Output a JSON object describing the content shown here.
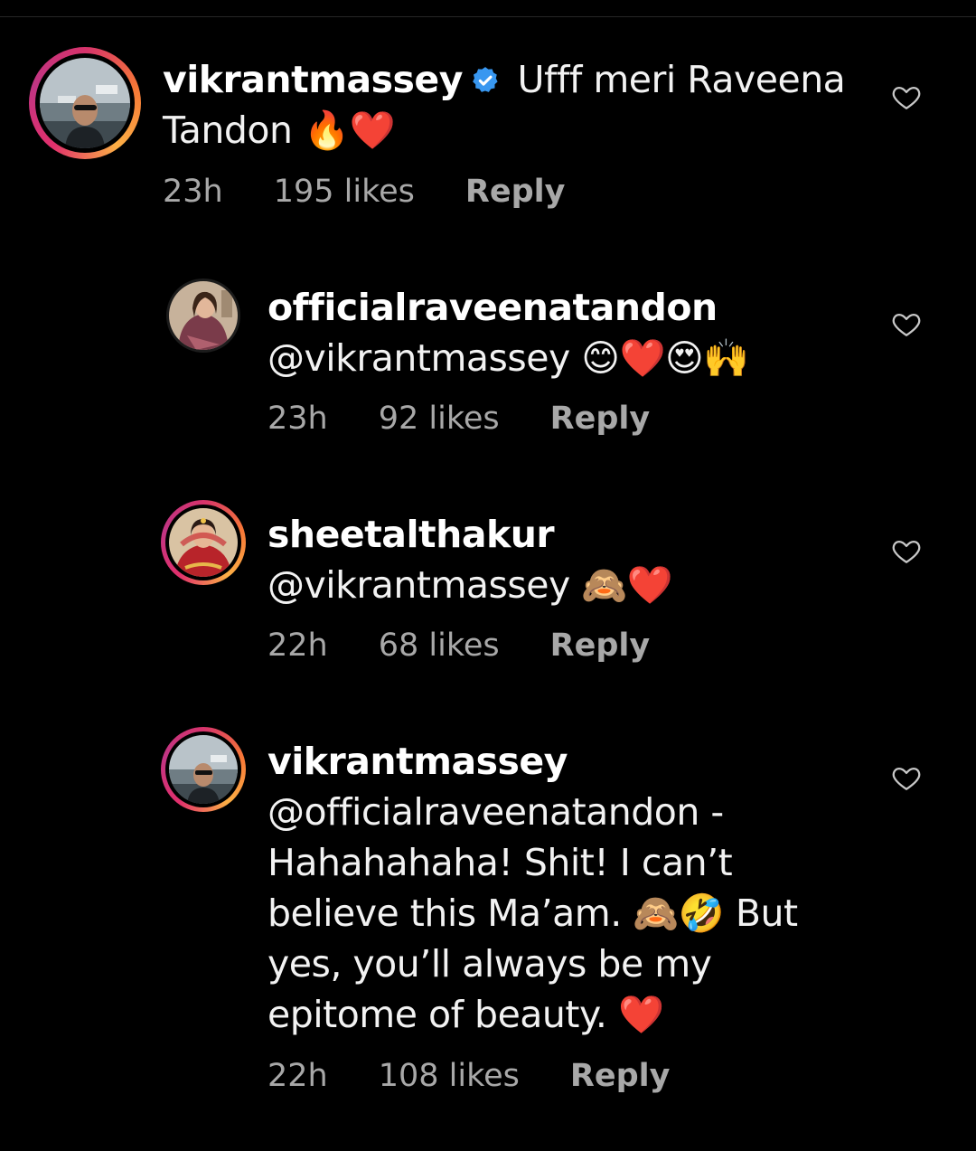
{
  "comments": [
    {
      "username": "vikrantmassey",
      "verified": true,
      "text": " Ufff meri Raveena Tandon 🔥❤️",
      "time": "23h",
      "likes": "195 likes",
      "reply": "Reply"
    },
    {
      "username": "officialraveenatandon",
      "verified": false,
      "text": "@vikrantmassey 😊❤️😍🙌",
      "time": "23h",
      "likes": "92 likes",
      "reply": "Reply"
    },
    {
      "username": "sheetalthakur",
      "verified": false,
      "text": "@vikrantmassey 🙈❤️",
      "time": "22h",
      "likes": "68 likes",
      "reply": "Reply"
    },
    {
      "username": "vikrantmassey",
      "verified": false,
      "text": "@officialraveenatandon - Hahahahaha! Shit! I can’t believe this Ma’am. 🙈🤣 But yes, you’ll always be my epitome of beauty. ❤️",
      "time": "22h",
      "likes": "108 likes",
      "reply": "Reply"
    }
  ],
  "colors": {
    "background": "#000000",
    "text": "#f2f2f2",
    "meta": "#a8a8a8",
    "verified": "#3897f0"
  },
  "icons": {
    "like": "heart-outline-icon",
    "verified": "verified-badge-icon"
  }
}
